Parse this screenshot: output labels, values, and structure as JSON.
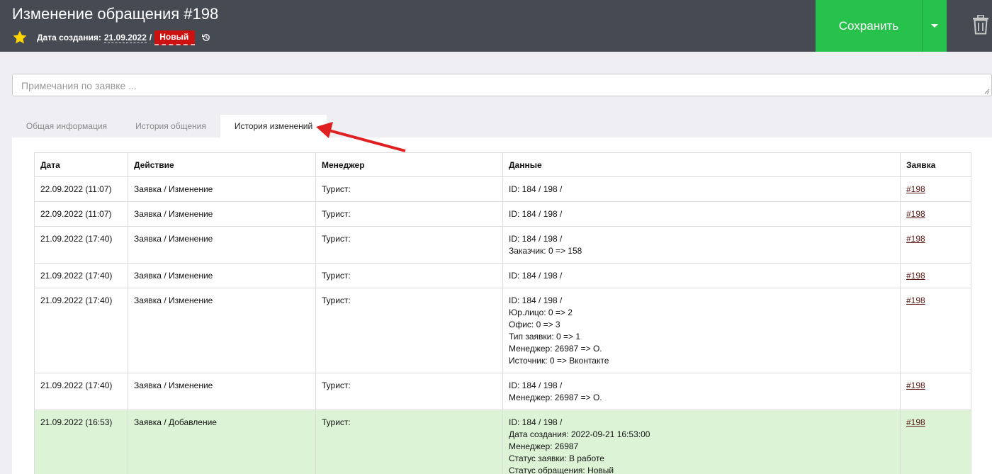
{
  "header": {
    "title": "Изменение обращения #198",
    "created_label": "Дата создания:",
    "created_date": "21.09.2022",
    "separator": "/",
    "status_badge": "Новый",
    "save_label": "Сохранить",
    "icons": [
      "star-icon",
      "history-icon",
      "chevron-down-icon",
      "trash-icon"
    ]
  },
  "notes": {
    "placeholder": "Примечания по заявке ..."
  },
  "tabs": [
    {
      "label": "Общая информация",
      "active": false
    },
    {
      "label": "История общения",
      "active": false
    },
    {
      "label": "История изменений",
      "active": true
    }
  ],
  "table": {
    "columns": [
      "Дата",
      "Действие",
      "Менеджер",
      "Данные",
      "Заявка"
    ],
    "rows": [
      {
        "date": "22.09.2022 (11:07)",
        "action": "Заявка / Изменение",
        "manager": "Турист:",
        "data": [
          "ID: 184 / 198 /"
        ],
        "link": "#198",
        "highlight": false
      },
      {
        "date": "22.09.2022 (11:07)",
        "action": "Заявка / Изменение",
        "manager": "Турист:",
        "data": [
          "ID: 184 / 198 /"
        ],
        "link": "#198",
        "highlight": false
      },
      {
        "date": "21.09.2022 (17:40)",
        "action": "Заявка / Изменение",
        "manager": "Турист:",
        "data": [
          "ID: 184 / 198 /",
          "Заказчик: 0 => 158"
        ],
        "link": "#198",
        "highlight": false
      },
      {
        "date": "21.09.2022 (17:40)",
        "action": "Заявка / Изменение",
        "manager": "Турист:",
        "data": [
          "ID: 184 / 198 /"
        ],
        "link": "#198",
        "highlight": false
      },
      {
        "date": "21.09.2022 (17:40)",
        "action": "Заявка / Изменение",
        "manager": "Турист:",
        "data": [
          "ID: 184 / 198 /",
          "Юр.лицо: 0 => 2",
          "Офис: 0 => 3",
          "Тип заявки: 0 => 1",
          "Менеджер: 26987 => О.",
          "Источник: 0 => Вконтакте"
        ],
        "link": "#198",
        "highlight": false
      },
      {
        "date": "21.09.2022 (17:40)",
        "action": "Заявка / Изменение",
        "manager": "Турист:",
        "data": [
          "ID: 184 / 198 /",
          "Менеджер: 26987 => О."
        ],
        "link": "#198",
        "highlight": false
      },
      {
        "date": "21.09.2022 (16:53)",
        "action": "Заявка / Добавление",
        "manager": "Турист:",
        "data": [
          "ID: 184 / 198 /",
          "Дата создания: 2022-09-21 16:53:00",
          "Менеджер: 26987",
          "Статус заявки: В работе",
          "Статус обращения: Новый"
        ],
        "link": "#198",
        "highlight": true
      }
    ]
  },
  "colors": {
    "header_bg": "#464a52",
    "save_green": "#27c24c",
    "badge_red": "#cc1111",
    "row_highlight": "#dcf3d6",
    "annotation_arrow": "#e02020"
  }
}
